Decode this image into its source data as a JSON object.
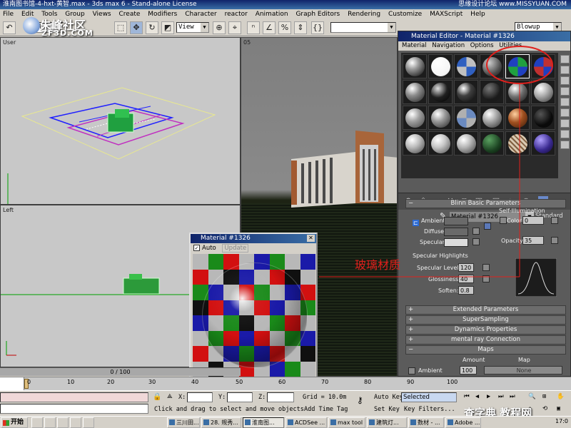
{
  "window": {
    "title": "淮南图书馆-4-hxt-黄智.max - 3ds max 6 - Stand-alone License",
    "corner_watermark": "思缘设计论坛 www.MISSYUAN.COM"
  },
  "logo": {
    "line1": "朱峰社区",
    "line2": "ZF3D.COM"
  },
  "menu": [
    "File",
    "Edit",
    "Tools",
    "Group",
    "Views",
    "Create",
    "Modifiers",
    "Character",
    "reactor",
    "Animation",
    "Graph Editors",
    "Rendering",
    "Customize",
    "MAXScript",
    "Help"
  ],
  "toolbar": {
    "selection_filter": "All",
    "ref_coord": "View",
    "named_selection": "",
    "render_type": "Blowup"
  },
  "viewports": {
    "top_left": "User",
    "bottom_left": "Left",
    "perspective": "05"
  },
  "material_editor": {
    "title": "Material Editor - Material #1326",
    "menu": [
      "Material",
      "Navigation",
      "Options",
      "Utilities"
    ],
    "material_name": "Material #1326",
    "material_type": "Standard",
    "rollouts": {
      "blinn": "Blinn Basic Parameters",
      "extended": "Extended Parameters",
      "supersampling": "SuperSampling",
      "dynamics": "Dynamics Properties",
      "mental_ray": "mental ray Connection",
      "maps": "Maps"
    },
    "labels": {
      "self_illum": "Self-Illumination",
      "color": "Color",
      "color_value": "0",
      "ambient": "Ambient:",
      "diffuse": "Diffuse:",
      "specular": "Specular:",
      "opacity": "Opacity:",
      "opacity_value": "35",
      "spec_highlights": "Specular Highlights",
      "spec_level": "Specular Level:",
      "spec_level_value": "120",
      "glossiness": "Glossiness:",
      "glossiness_value": "40",
      "soften": "Soften:",
      "soften_value": "0.8",
      "maps_amount": "Amount",
      "maps_map": "Map",
      "maps_ambient": "Ambient",
      "maps_ambient_amount": "100",
      "maps_ambient_map": "None"
    },
    "colors": {
      "ambient": "#6a6a6a",
      "diffuse": "#6a6a6a",
      "specular": "#dcdcdc"
    }
  },
  "material_window": {
    "title": "Material #1326",
    "auto_label": "Auto",
    "update_label": "Update",
    "checker_colors": [
      "#d21010",
      "#1a8a1a",
      "#1a1aa8",
      "#b8b8b8",
      "#101010"
    ]
  },
  "annotation": {
    "text": "玻璃材质"
  },
  "timeline": {
    "frame": "0 / 100",
    "ticks": [
      "0",
      "10",
      "20",
      "30",
      "40",
      "50",
      "60",
      "70",
      "80",
      "90",
      "100"
    ]
  },
  "status": {
    "x_label": "X:",
    "y_label": "Y:",
    "z_label": "Z:",
    "grid": "Grid = 10.0m",
    "prompt": "Click and drag to select and move objects",
    "add_time_tag": "Add Time Tag",
    "auto_key": "Auto Key",
    "selected": "Selected",
    "set_key": "Set Key",
    "key_filters": "Key Filters..."
  },
  "taskbar": {
    "start": "开始",
    "items": [
      "三川田...",
      "28. 规秀...",
      "淮南图...",
      "ACDSee ...",
      "max tool",
      "建筑灯...",
      "数材 - ...",
      "Adobe ..."
    ],
    "clock": "17:0"
  },
  "bottom_watermark": "查字典 教程网"
}
